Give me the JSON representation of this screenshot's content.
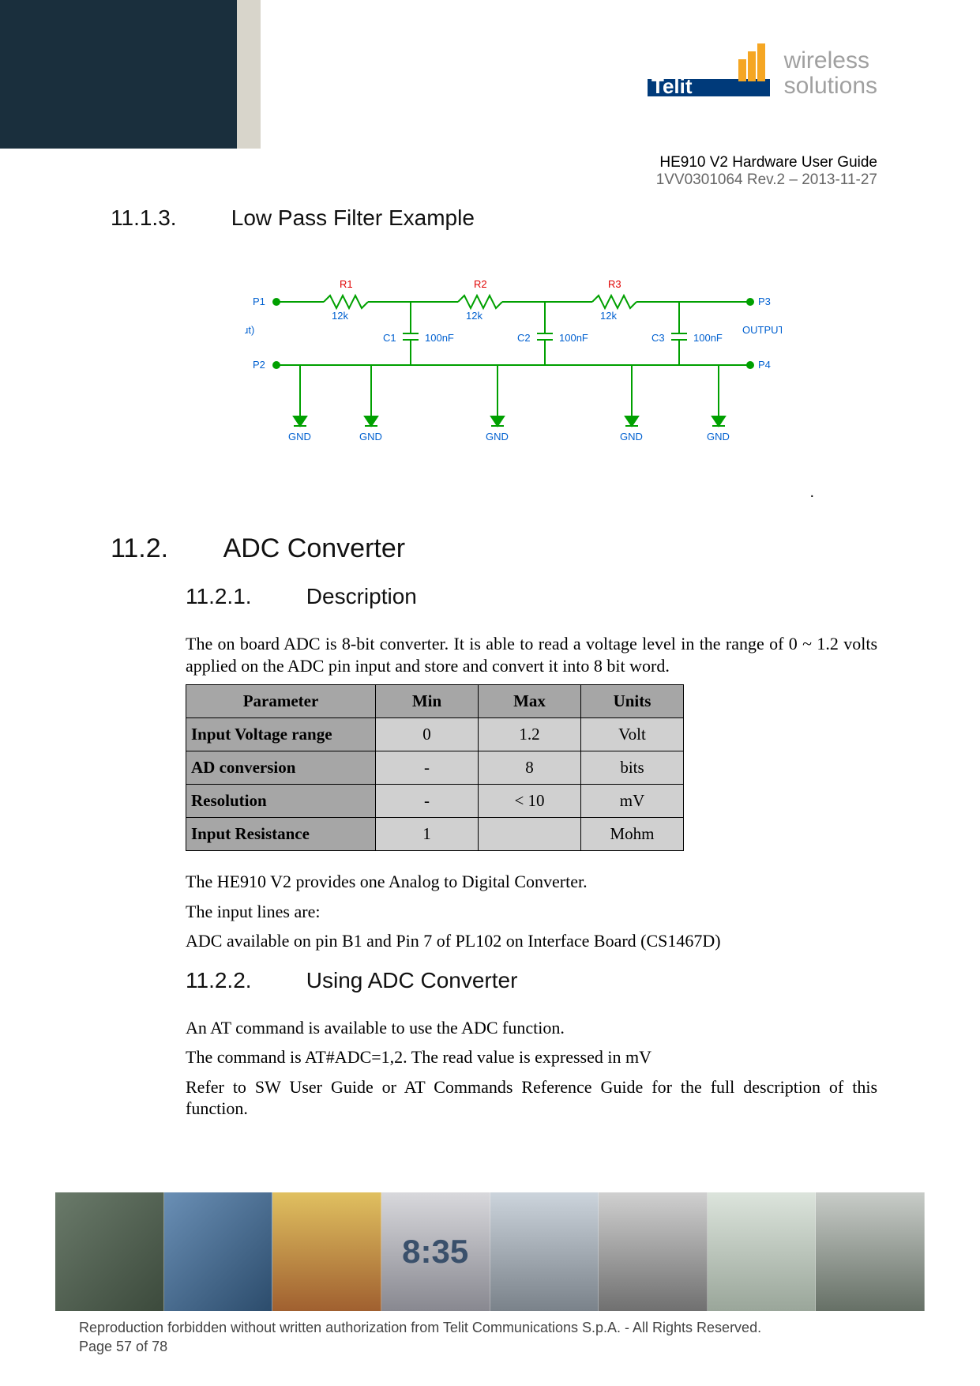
{
  "header": {
    "brand": "Telit",
    "tagline1": "wireless",
    "tagline2": "solutions",
    "doc_title": "HE910 V2 Hardware User Guide",
    "doc_rev": "1VV0301064 Rev.2 – 2013-11-27"
  },
  "sections": {
    "s_11_1_3": {
      "num": "11.1.3.",
      "title": "Low Pass Filter Example"
    },
    "s_11_2": {
      "num": "11.2.",
      "title": "ADC Converter"
    },
    "s_11_2_1": {
      "num": "11.2.1.",
      "title": "Description"
    },
    "s_11_2_2": {
      "num": "11.2.2.",
      "title": "Using ADC Converter"
    }
  },
  "circuit": {
    "labels": {
      "p1": "P1",
      "p2": "P2",
      "p3": "P3",
      "p4": "P4",
      "r1": "R1",
      "r2": "R2",
      "r3": "R3",
      "c1": "C1",
      "c2": "C2",
      "c3": "C3",
      "r_val": "12k",
      "c_val": "100nF",
      "gnd": "GND",
      "input": "INPUT (dac_out)",
      "output": "OUTPUT"
    }
  },
  "desc": {
    "p1": "The on board ADC is 8-bit converter. It is able to read a voltage level in the range of 0 ~ 1.2 volts applied on the ADC pin input and store and convert it into 8 bit word.",
    "p2": "The HE910 V2 provides one Analog to Digital Converter.",
    "p3": "The input lines are:",
    "p4": "ADC available on pin B1 and Pin 7 of PL102 on Interface Board (CS1467D)"
  },
  "table": {
    "headers": [
      "Parameter",
      "Min",
      "Max",
      "Units"
    ],
    "rows": [
      {
        "param": "Input Voltage range",
        "min": "0",
        "max": "1.2",
        "units": "Volt"
      },
      {
        "param": "AD conversion",
        "min": "-",
        "max": "8",
        "units": "bits"
      },
      {
        "param": "Resolution",
        "min": "-",
        "max": "<  10",
        "units": "mV"
      },
      {
        "param": "Input Resistance",
        "min": "1",
        "max": "",
        "units": "Mohm"
      }
    ]
  },
  "using": {
    "p1": "An AT command is available to use the ADC function.",
    "p2": "The command is AT#ADC=1,2.  The read value is expressed in mV",
    "p3": "Refer to SW User Guide or AT Commands Reference Guide for the full description of this function."
  },
  "footer": {
    "line1": "Reproduction forbidden without written authorization from Telit Communications S.p.A. - All Rights Reserved.",
    "line2": "Page 57 of 78"
  },
  "dot": "."
}
